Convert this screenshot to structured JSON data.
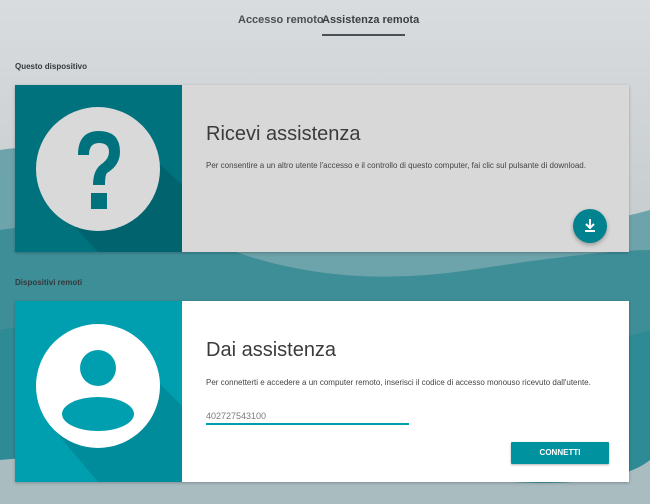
{
  "tabs": [
    {
      "label": "Accesso remoto",
      "selected": false
    },
    {
      "label": "Assistenza remota",
      "selected": true
    }
  ],
  "sections": {
    "this_device": "Questo dispositivo",
    "remote_devices": "Dispositivi remoti"
  },
  "receive_card": {
    "title": "Ricevi assistenza",
    "description": "Per consentire a un altro utente l'accesso e il controllo di questo computer, fai clic sul pulsante di download.",
    "icon": "question-mark-icon",
    "action_icon": "download-icon"
  },
  "give_card": {
    "title": "Dai assistenza",
    "description": "Per connetterti e accedere a un computer remoto, inserisci il codice di accesso monouso ricevuto dall'utente.",
    "icon": "person-icon",
    "code_value": "402727543100",
    "connect_label": "CONNETTI"
  },
  "colors": {
    "accent": "#009faf",
    "dark_teal": "#00727d",
    "button": "#00939f"
  }
}
